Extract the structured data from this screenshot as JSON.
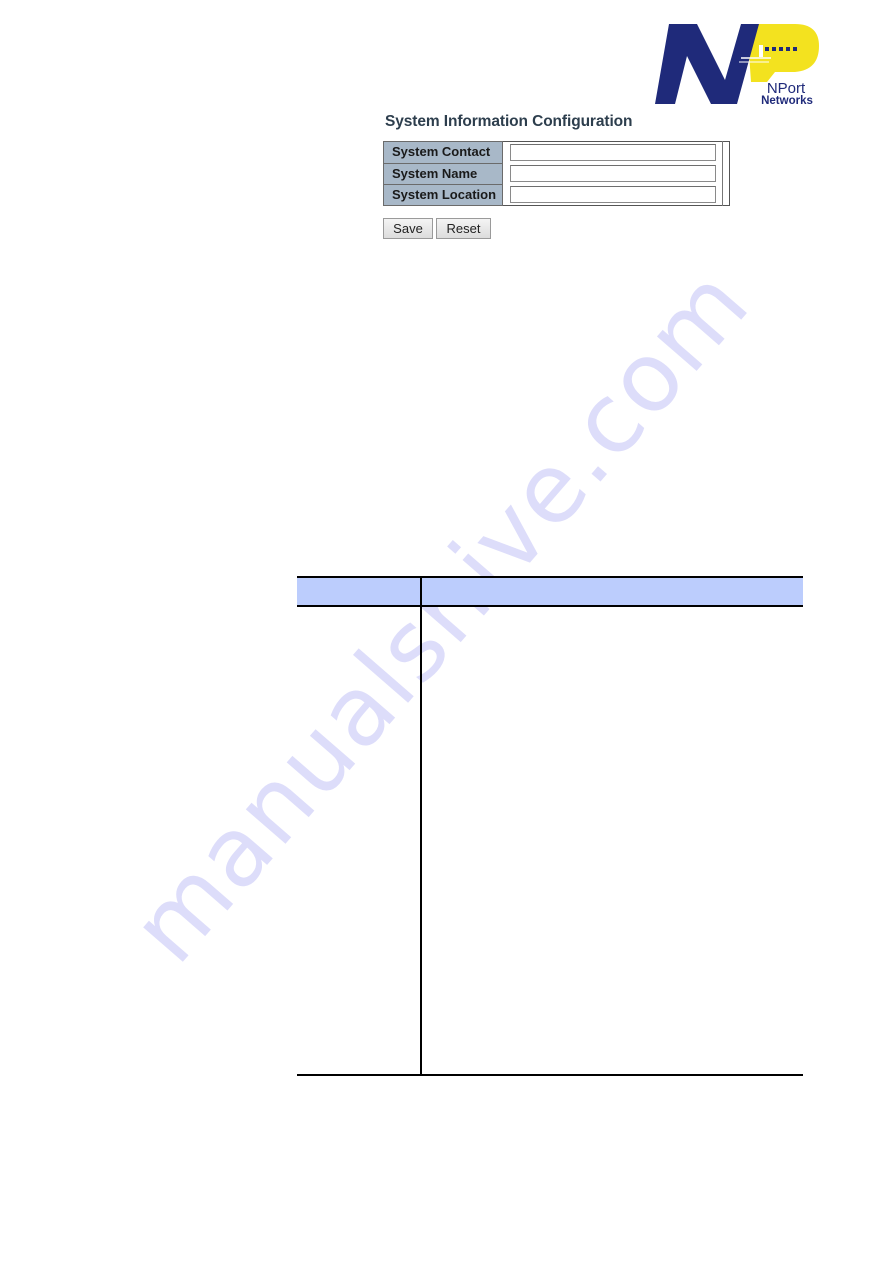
{
  "logo": {
    "brand_line1": "NPort",
    "brand_line2": "Networks",
    "colors": {
      "navy": "#1f2a7a",
      "yellow": "#f3e21f"
    }
  },
  "screenshot": {
    "title": "System Information Configuration",
    "fields": [
      {
        "label": "System Contact",
        "value": "",
        "placeholder": ""
      },
      {
        "label": "System Name",
        "value": "",
        "placeholder": ""
      },
      {
        "label": "System Location",
        "value": "",
        "placeholder": ""
      }
    ],
    "buttons": {
      "save_label": "Save",
      "reset_label": "Reset"
    }
  },
  "description_table": {
    "headers": [
      "",
      ""
    ],
    "rows": [
      [
        "",
        ""
      ]
    ],
    "header_color": "#bccdfd"
  },
  "watermark": {
    "text": "manualshive.com"
  }
}
